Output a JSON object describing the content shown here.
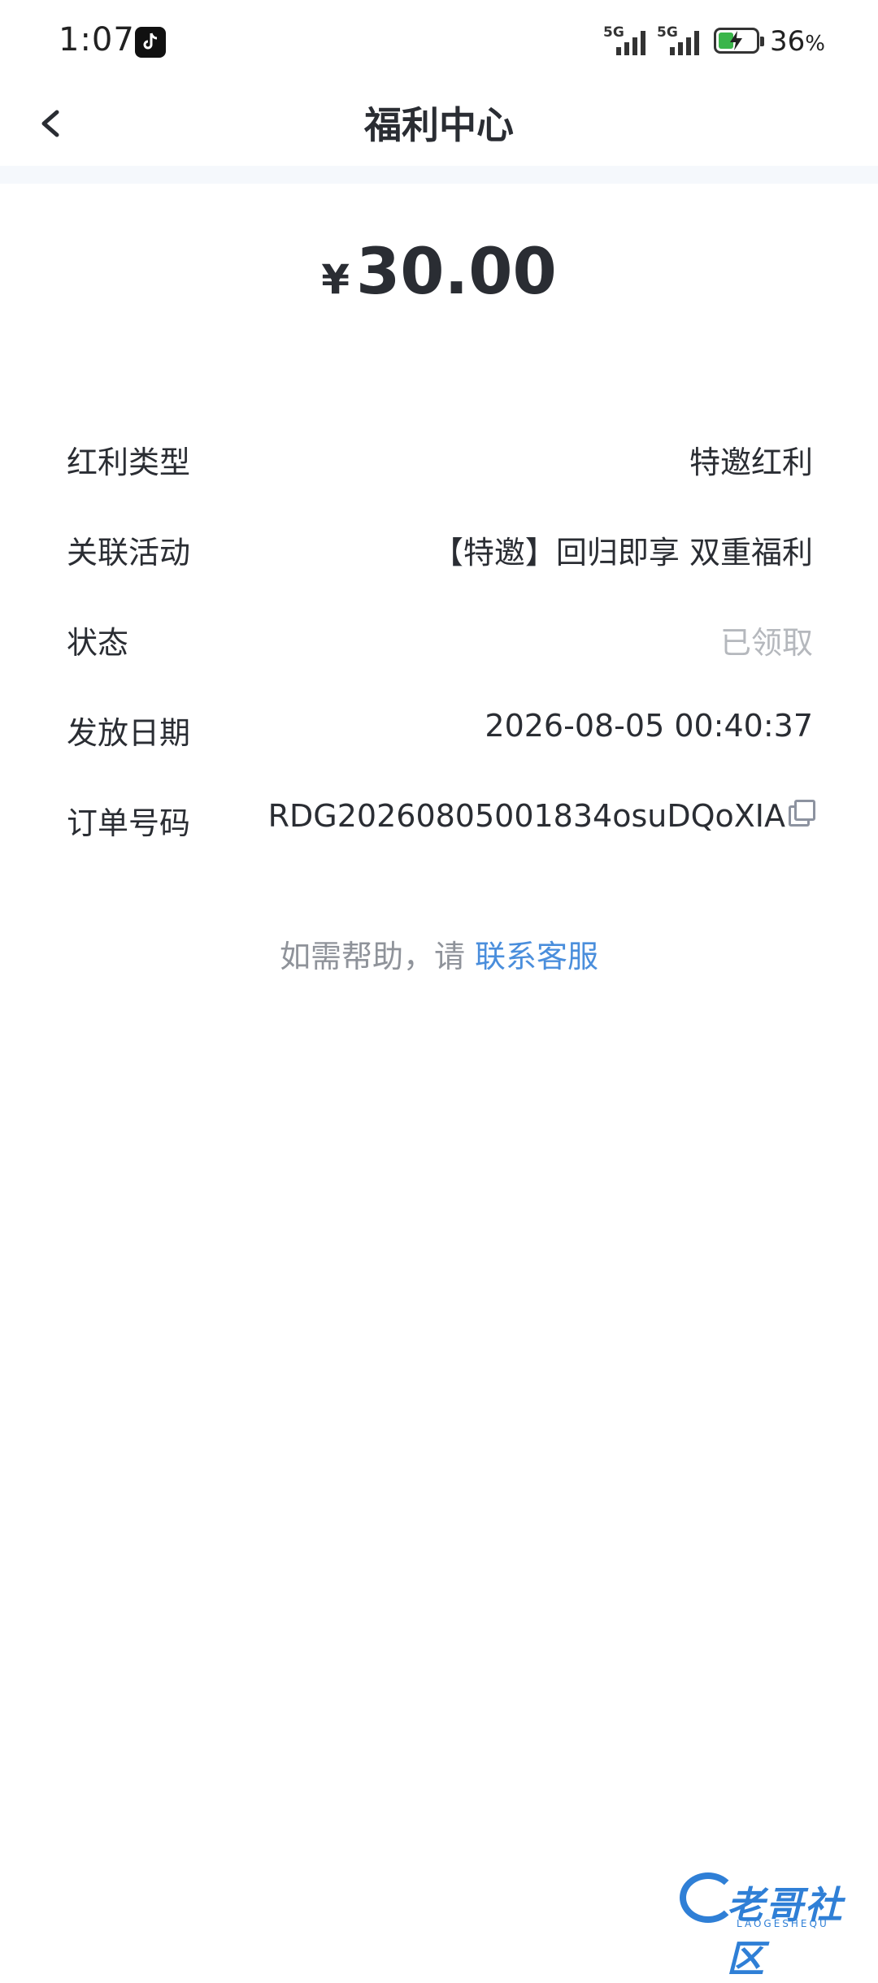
{
  "status_bar": {
    "time": "1:07",
    "network_1": "5G",
    "network_2": "5G",
    "battery_percent": "36",
    "battery_unit": "%"
  },
  "header": {
    "title": "福利中心"
  },
  "amount": {
    "currency": "¥",
    "value": "30.00"
  },
  "details": {
    "type_label": "红利类型",
    "type_value": "特邀红利",
    "activity_label": "关联活动",
    "activity_value": "【特邀】回归即享 双重福利",
    "status_label": "状态",
    "status_value": "已领取",
    "date_label": "发放日期",
    "date_value": "2026-08-05 00:40:37",
    "order_label": "订单号码",
    "order_value": "RDG20260805001834osuDQoXIA"
  },
  "help": {
    "prefix": "如需帮助，请 ",
    "link": "联系客服"
  },
  "watermark": {
    "text": "老哥社区",
    "subtext": "LAOGESHEQU"
  },
  "colors": {
    "link": "#4a8edc",
    "text": "#2a2d33",
    "muted": "#b5b8bd"
  }
}
